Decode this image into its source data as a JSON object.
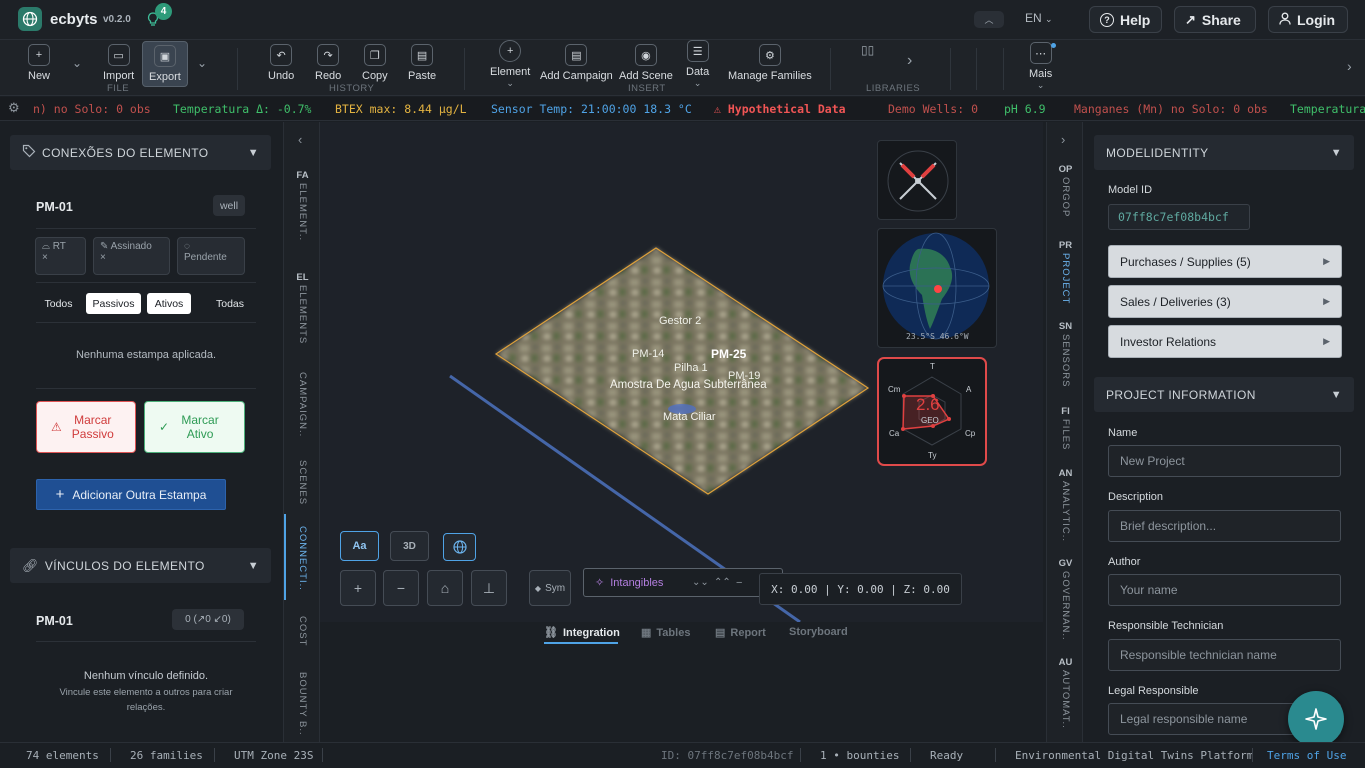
{
  "app": {
    "name": "ecbyts",
    "version": "v0.2.0",
    "notifications": "4",
    "language": "EN"
  },
  "header_buttons": {
    "help": "Help",
    "share": "Share",
    "login": "Login"
  },
  "ribbon": {
    "new": "New",
    "import": "Import",
    "export": "Export",
    "undo": "Undo",
    "redo": "Redo",
    "copy": "Copy",
    "paste": "Paste",
    "element": "Element",
    "add_campaign": "Add Campaign",
    "add_scene": "Add Scene",
    "data": "Data",
    "manage_families": "Manage Families",
    "more": "Mais",
    "groups": {
      "file": "FILE",
      "history": "HISTORY",
      "insert": "INSERT",
      "libraries": "LIBRARIES"
    }
  },
  "ticker": [
    {
      "text": "n) no Solo: 0 obs",
      "color": "#c0504d"
    },
    {
      "text": "Temperatura Δ: -0.7%",
      "color": "#3fbf6a"
    },
    {
      "text": "BTEX max: 8.44 µg/L",
      "color": "#e3b341"
    },
    {
      "text": "Sensor Temp: 21:00:00 18.3 °C",
      "color": "#4fa3e6"
    },
    {
      "text": "⚠ Hypothetical Data",
      "color": "#f05555"
    },
    {
      "text": "Demo Wells: 0",
      "color": "#c0504d"
    },
    {
      "text": "pH 6.9",
      "color": "#3fbf6a"
    },
    {
      "text": "Manganes (Mn) no Solo: 0 obs",
      "color": "#c0504d"
    },
    {
      "text": "Temperatura",
      "color": "#3fbf6a"
    }
  ],
  "left_panel": {
    "connections_title": "CONEXÕES DO ELEMENTO",
    "element_id": "PM-01",
    "element_type": "well",
    "chips": [
      {
        "label": "RT",
        "sub": "×"
      },
      {
        "label": "Assinado",
        "sub": "×"
      },
      {
        "label": "",
        "sub": "Pendente"
      }
    ],
    "filters": [
      "Todos",
      "Passivos",
      "Ativos",
      "Todas"
    ],
    "empty_stamps": "Nenhuma estampa aplicada.",
    "mark_passive": "Marcar Passivo",
    "mark_active": "Marcar Ativo",
    "add_stamp": "Adicionar Outra Estampa",
    "links_title": "VÍNCULOS DO ELEMENTO",
    "links_element": "PM-01",
    "links_count": "0 (↗0 ↙0)",
    "no_links": "Nenhum vínculo definido.",
    "no_links_hint": "Vincule este elemento a outros para criar relações."
  },
  "left_tabs": [
    {
      "code": "FA",
      "label": "ELEMENT.."
    },
    {
      "code": "EL",
      "label": "ELEMENTS"
    },
    {
      "code": "",
      "label": "CAMPAIGN.."
    },
    {
      "code": "",
      "label": "SCENES"
    },
    {
      "code": "",
      "label": "CONNECTI.."
    },
    {
      "code": "",
      "label": "COST"
    },
    {
      "code": "",
      "label": "BOUNTY B.."
    }
  ],
  "right_tabs": [
    {
      "code": "OP",
      "label": "ORGOP"
    },
    {
      "code": "PR",
      "label": "PROJECT"
    },
    {
      "code": "SN",
      "label": "SENSORS"
    },
    {
      "code": "FI",
      "label": "FILES"
    },
    {
      "code": "AN",
      "label": "ANALYTIC.."
    },
    {
      "code": "GV",
      "label": "GOVERNAN.."
    },
    {
      "code": "AU",
      "label": "AUTOMAT.."
    }
  ],
  "viewport": {
    "labels": [
      "Gestor 2",
      "PM-14",
      "PM-25",
      "Pilha 1",
      "PM-19",
      "Amostra De Agua Subterrânea",
      "Mata Ciliar"
    ],
    "globe_coords": "23.5°S 46.6°W",
    "radar_value": "2.6",
    "radar_center": "GEO",
    "radar_axes": [
      "T",
      "A",
      "Cp",
      "Ty",
      "Ca",
      "Cm"
    ],
    "text_toggle": "Aa",
    "mode_3d": "3D",
    "sym_label": "Sym",
    "intangibles_label": "Intangibles",
    "coords": "X: 0.00 | Y: 0.00 | Z: 0.00"
  },
  "bottom_tabs": [
    "Integration",
    "Tables",
    "Report",
    "Storyboard"
  ],
  "right_panel": {
    "model_identity_title": "MODELIDENTITY",
    "model_id_label": "Model ID",
    "model_id": "07ff8c7ef08b4bcf",
    "accordions": [
      "Purchases / Supplies (5)",
      "Sales / Deliveries (3)",
      "Investor Relations"
    ],
    "project_info_title": "PROJECT INFORMATION",
    "fields": [
      {
        "label": "Name",
        "placeholder": "New Project"
      },
      {
        "label": "Description",
        "placeholder": "Brief description..."
      },
      {
        "label": "Author",
        "placeholder": "Your name"
      },
      {
        "label": "Responsible Technician",
        "placeholder": "Responsible technician name"
      },
      {
        "label": "Legal Responsible",
        "placeholder": "Legal responsible name"
      }
    ]
  },
  "status_bar": {
    "elements": "74 elements",
    "families": "26 families",
    "utm": "UTM Zone 23S",
    "id": "ID: 07ff8c7ef08b4bcf",
    "bounties": "1 • bounties",
    "ready": "Ready",
    "platform": "Environmental Digital Twins Platform",
    "terms": "Terms of Use"
  }
}
